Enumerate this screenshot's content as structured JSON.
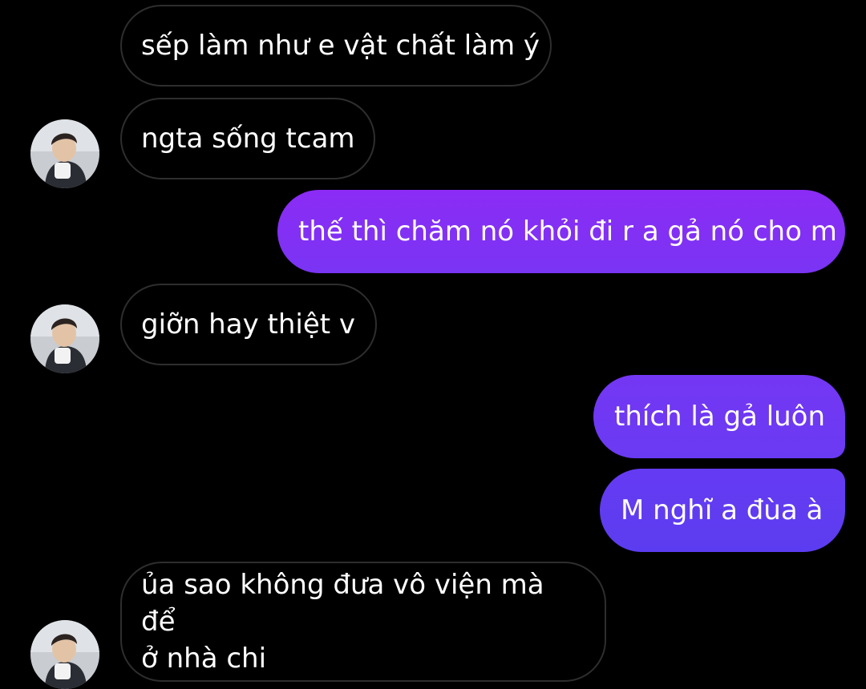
{
  "theme": {
    "background": "#000000",
    "incoming_border": "#2e2e2e",
    "outgoing_gradient_top": "#8b2cf5",
    "outgoing_gradient_bottom": "#5b3cf0"
  },
  "messages": [
    {
      "direction": "incoming",
      "text": "sếp làm như e vật chất làm ý",
      "avatar": false
    },
    {
      "direction": "incoming",
      "text": "ngta sống tcam",
      "avatar": "avatar-photo"
    },
    {
      "direction": "outgoing",
      "text": "thế thì chăm nó khỏi đi r a gả nó cho m"
    },
    {
      "direction": "incoming",
      "text": "giỡn hay thiệt v",
      "avatar": "avatar-photo"
    },
    {
      "direction": "outgoing",
      "text": "thích là gả luôn"
    },
    {
      "direction": "outgoing",
      "text": "M nghĩ a đùa à"
    },
    {
      "direction": "incoming",
      "text": "ủa sao không đưa vô viện mà để\nở nhà chi",
      "avatar": "avatar-photo"
    }
  ]
}
